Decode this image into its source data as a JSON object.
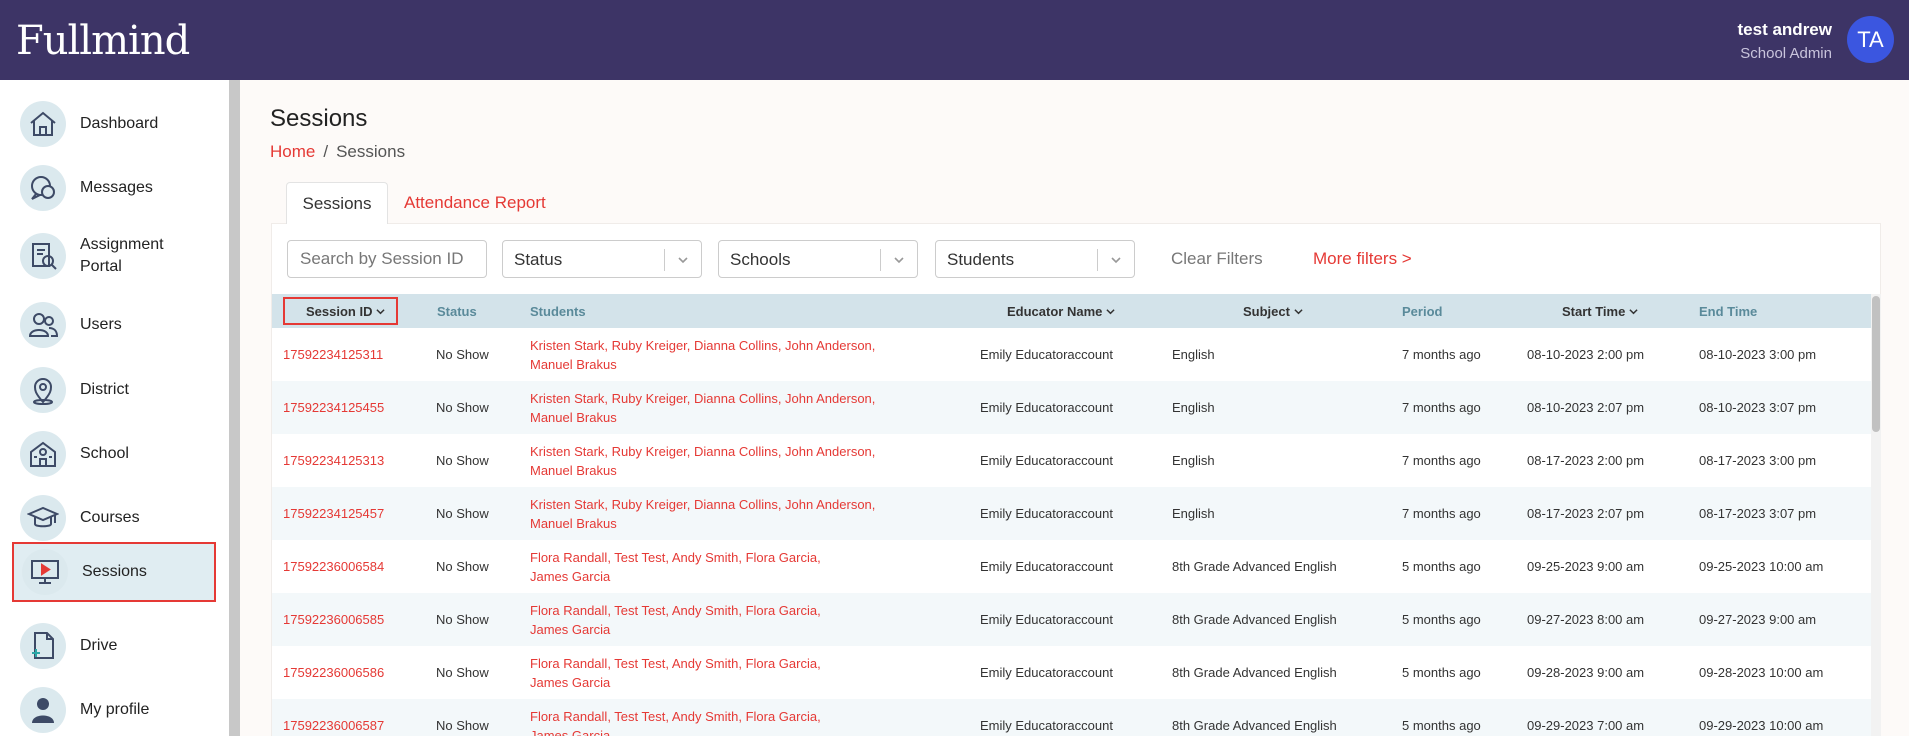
{
  "app": {
    "logo": "Fullmind",
    "user_name": "test andrew",
    "user_role": "School Admin",
    "avatar_initials": "TA"
  },
  "sidebar": {
    "items": [
      {
        "label": "Dashboard",
        "icon": "house-icon"
      },
      {
        "label": "Messages",
        "icon": "chat-icon"
      },
      {
        "label": "Assignment Portal",
        "icon": "document-search-icon"
      },
      {
        "label": "Users",
        "icon": "users-icon"
      },
      {
        "label": "District",
        "icon": "location-pin-icon"
      },
      {
        "label": "School",
        "icon": "school-building-icon"
      },
      {
        "label": "Courses",
        "icon": "graduation-cap-icon"
      },
      {
        "label": "Sessions",
        "icon": "monitor-play-icon",
        "active": true
      },
      {
        "label": "Drive",
        "icon": "file-add-icon"
      },
      {
        "label": "My profile",
        "icon": "user-icon"
      }
    ]
  },
  "page": {
    "title": "Sessions",
    "breadcrumb": {
      "home": "Home",
      "separator": "/",
      "current": "Sessions"
    },
    "tabs": [
      "Sessions",
      "Attendance Report"
    ]
  },
  "filters": {
    "search_placeholder": "Search by Session ID",
    "status": "Status",
    "schools": "Schools",
    "students": "Students",
    "clear": "Clear Filters",
    "more": "More filters >"
  },
  "table": {
    "columns": [
      "Session ID",
      "Status",
      "Students",
      "Educator Name",
      "Subject",
      "Period",
      "Start Time",
      "End Time"
    ],
    "rows": [
      {
        "id": "17592234125311",
        "status": "No Show",
        "students_line1": "Kristen Stark, Ruby Kreiger, Dianna Collins, John Anderson,",
        "students_line2": "Manuel Brakus",
        "educator": "Emily Educatoraccount",
        "subject": "English",
        "period": "7 months ago",
        "start": "08-10-2023 2:00 pm",
        "end": "08-10-2023 3:00 pm"
      },
      {
        "id": "17592234125455",
        "status": "No Show",
        "students_line1": "Kristen Stark, Ruby Kreiger, Dianna Collins, John Anderson,",
        "students_line2": "Manuel Brakus",
        "educator": "Emily Educatoraccount",
        "subject": "English",
        "period": "7 months ago",
        "start": "08-10-2023 2:07 pm",
        "end": "08-10-2023 3:07 pm"
      },
      {
        "id": "17592234125313",
        "status": "No Show",
        "students_line1": "Kristen Stark, Ruby Kreiger, Dianna Collins, John Anderson,",
        "students_line2": "Manuel Brakus",
        "educator": "Emily Educatoraccount",
        "subject": "English",
        "period": "7 months ago",
        "start": "08-17-2023 2:00 pm",
        "end": "08-17-2023 3:00 pm"
      },
      {
        "id": "17592234125457",
        "status": "No Show",
        "students_line1": "Kristen Stark, Ruby Kreiger, Dianna Collins, John Anderson,",
        "students_line2": "Manuel Brakus",
        "educator": "Emily Educatoraccount",
        "subject": "English",
        "period": "7 months ago",
        "start": "08-17-2023 2:07 pm",
        "end": "08-17-2023 3:07 pm"
      },
      {
        "id": "17592236006584",
        "status": "No Show",
        "students_line1": "Flora Randall, Test Test, Andy Smith, Flora Garcia,",
        "students_line2": "James Garcia",
        "educator": "Emily Educatoraccount",
        "subject": "8th Grade Advanced English",
        "period": "5 months ago",
        "start": "09-25-2023 9:00 am",
        "end": "09-25-2023 10:00 am"
      },
      {
        "id": "17592236006585",
        "status": "No Show",
        "students_line1": "Flora Randall, Test Test, Andy Smith, Flora Garcia,",
        "students_line2": "James Garcia",
        "educator": "Emily Educatoraccount",
        "subject": "8th Grade Advanced English",
        "period": "5 months ago",
        "start": "09-27-2023 8:00 am",
        "end": "09-27-2023 9:00 am"
      },
      {
        "id": "17592236006586",
        "status": "No Show",
        "students_line1": "Flora Randall, Test Test, Andy Smith, Flora Garcia,",
        "students_line2": "James Garcia",
        "educator": "Emily Educatoraccount",
        "subject": "8th Grade Advanced English",
        "period": "5 months ago",
        "start": "09-28-2023 9:00 am",
        "end": "09-28-2023 10:00 am"
      },
      {
        "id": "17592236006587",
        "status": "No Show",
        "students_line1": "Flora Randall, Test Test, Andy Smith, Flora Garcia,",
        "students_line2": "James Garcia",
        "educator": "Emily Educatoraccount",
        "subject": "8th Grade Advanced English",
        "period": "5 months ago",
        "start": "09-29-2023 7:00 am",
        "end": "09-29-2023 10:00 am"
      }
    ]
  },
  "colors": {
    "topbar": "#3d3466",
    "accent": "#e53935",
    "table_header": "#d3e3ea",
    "avatar": "#3b56e0"
  }
}
